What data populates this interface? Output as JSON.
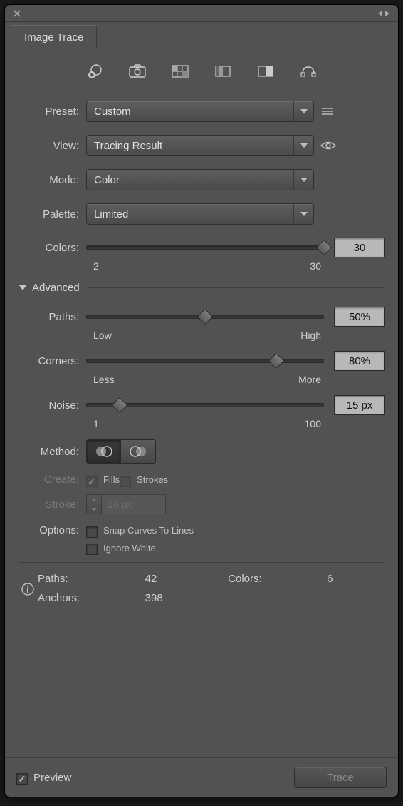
{
  "panel_title": "Image Trace",
  "labels": {
    "preset": "Preset:",
    "view": "View:",
    "mode": "Mode:",
    "palette": "Palette:",
    "colors": "Colors:",
    "advanced": "Advanced",
    "paths": "Paths:",
    "corners": "Corners:",
    "noise": "Noise:",
    "method": "Method:",
    "create": "Create:",
    "stroke": "Stroke:",
    "options": "Options:"
  },
  "preset": {
    "value": "Custom"
  },
  "view": {
    "value": "Tracing Result"
  },
  "mode": {
    "value": "Color"
  },
  "palette": {
    "value": "Limited"
  },
  "colors": {
    "value": "30",
    "min": "2",
    "max": "30",
    "thumb_pct": 100
  },
  "paths": {
    "value": "50%",
    "low": "Low",
    "high": "High",
    "thumb_pct": 50
  },
  "corners": {
    "value": "80%",
    "low": "Less",
    "high": "More",
    "thumb_pct": 80
  },
  "noise": {
    "value": "15 px",
    "min": "1",
    "max": "100",
    "thumb_pct": 14
  },
  "create": {
    "fills": "Fills",
    "strokes": "Strokes"
  },
  "stroke_value": "10 px",
  "options": {
    "snap": "Snap Curves To Lines",
    "ignore": "Ignore White"
  },
  "stats": {
    "paths_k": "Paths:",
    "paths_v": "42",
    "colors_k": "Colors:",
    "colors_v": "6",
    "anchors_k": "Anchors:",
    "anchors_v": "398"
  },
  "footer": {
    "preview": "Preview",
    "trace": "Trace"
  }
}
